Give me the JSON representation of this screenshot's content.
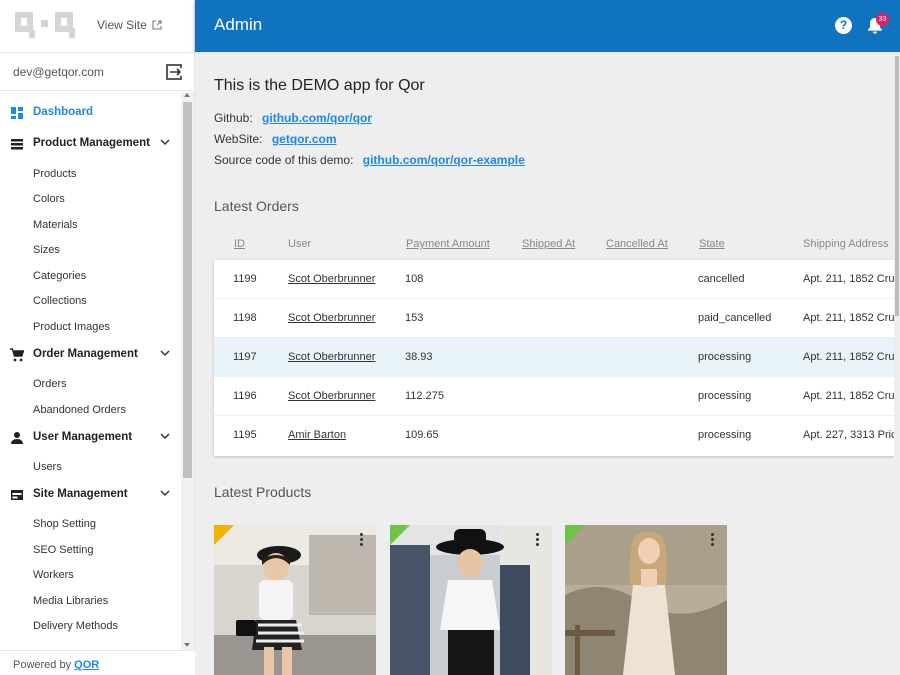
{
  "sidebar": {
    "view_site": "View Site",
    "user_email": "dev@getqor.com",
    "menu": {
      "dashboard": "Dashboard",
      "product_management": "Product Management",
      "products": "Products",
      "colors": "Colors",
      "materials": "Materials",
      "sizes": "Sizes",
      "categories": "Categories",
      "collections": "Collections",
      "product_images": "Product Images",
      "order_management": "Order Management",
      "orders": "Orders",
      "abandoned_orders": "Abandoned Orders",
      "user_management": "User Management",
      "users": "Users",
      "site_management": "Site Management",
      "shop_setting": "Shop Setting",
      "seo_setting": "SEO Setting",
      "workers": "Workers",
      "media_libraries": "Media Libraries",
      "delivery_methods": "Delivery Methods"
    },
    "powered_prefix": "Powered by",
    "powered_link": "QOR"
  },
  "topbar": {
    "title": "Admin",
    "notification_count": "33"
  },
  "main": {
    "demo_title": "This is the DEMO app for Qor",
    "github_label": "Github:",
    "github_link": "github.com/qor/qor",
    "website_label": "WebSite:",
    "website_link": "getqor.com",
    "source_label": "Source code of this demo:",
    "source_link": "github.com/qor/qor-example",
    "latest_orders": "Latest Orders",
    "latest_products": "Latest Products"
  },
  "orders": {
    "headers": {
      "id": "ID",
      "user": "User",
      "payment_amount": "Payment Amount",
      "shipped_at": "Shipped At",
      "cancelled_at": "Cancelled At",
      "state": "State",
      "shipping_address": "Shipping Address"
    },
    "rows": [
      {
        "id": "1199",
        "user": "Scot Oberbrunner",
        "amount": "108",
        "state": "cancelled",
        "address": "Apt. 211, 1852 Cru"
      },
      {
        "id": "1198",
        "user": "Scot Oberbrunner",
        "amount": "153",
        "state": "paid_cancelled",
        "address": "Apt. 211, 1852 Cru"
      },
      {
        "id": "1197",
        "user": "Scot Oberbrunner",
        "amount": "38.93",
        "state": "processing",
        "address": "Apt. 211, 1852 Cru"
      },
      {
        "id": "1196",
        "user": "Scot Oberbrunner",
        "amount": "112.275",
        "state": "processing",
        "address": "Apt. 211, 1852 Cru"
      },
      {
        "id": "1195",
        "user": "Amir Barton",
        "amount": "109.65",
        "state": "processing",
        "address": "Apt. 227, 3313 Pric"
      }
    ]
  },
  "colors": {
    "topbar": "#0f73bf",
    "accent": "#1e88e5",
    "badge": "#e91e63",
    "highlight_row": "#e8f4fa",
    "corner_yellow": "#f0b400",
    "corner_green": "#6cc644"
  },
  "icons": {
    "logo": "qor-logo",
    "external": "external-link-icon",
    "logout": "logout-icon",
    "dashboard": "dashboard-icon",
    "list": "list-icon",
    "cart": "cart-icon",
    "person": "person-icon",
    "site": "site-icon",
    "help": "help-icon",
    "bell": "bell-icon",
    "kebab": "more-vert-icon"
  }
}
